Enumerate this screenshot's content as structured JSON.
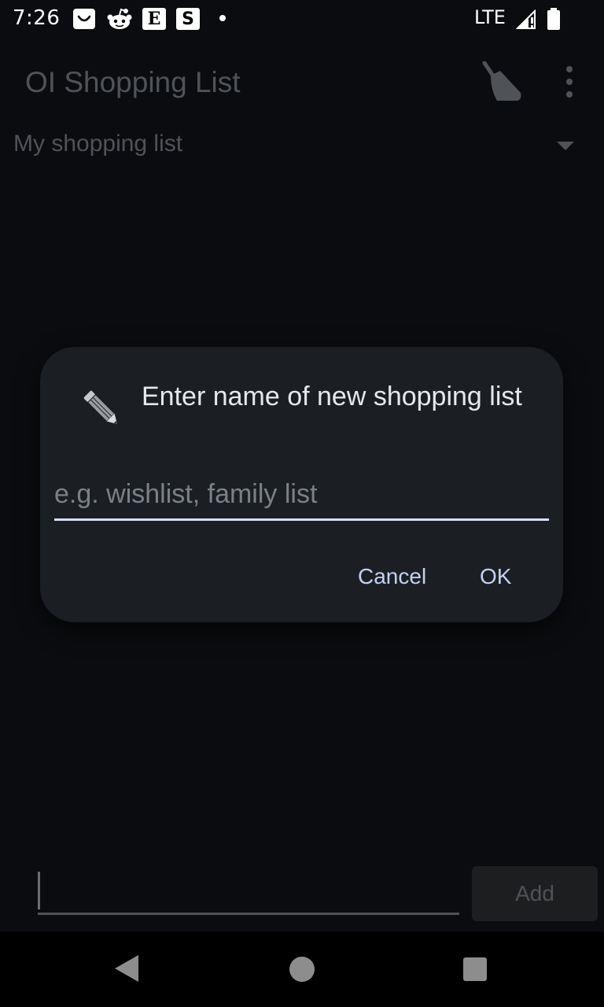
{
  "status_bar": {
    "time": "7:26",
    "notification_icons": [
      "shopping-bag-icon",
      "reddit-icon",
      "etsy-icon",
      "scribd-icon",
      "more-dot-icon"
    ],
    "etsy_letter": "E",
    "scribd_letter": "S",
    "network": "LTE"
  },
  "app_bar": {
    "title": "OI Shopping List",
    "actions": [
      "broom-clean-icon",
      "overflow-menu-icon"
    ]
  },
  "list_selector": {
    "selected": "My shopping list"
  },
  "dialog": {
    "title": "Enter name of new shopping list",
    "icon": "pencil-icon",
    "input_value": "",
    "input_placeholder": "e.g. wishlist, family list",
    "cancel_label": "Cancel",
    "ok_label": "OK"
  },
  "add_row": {
    "input_value": "",
    "button_label": "Add"
  },
  "nav_bar": {
    "buttons": [
      "back-icon",
      "home-icon",
      "recents-icon"
    ]
  }
}
